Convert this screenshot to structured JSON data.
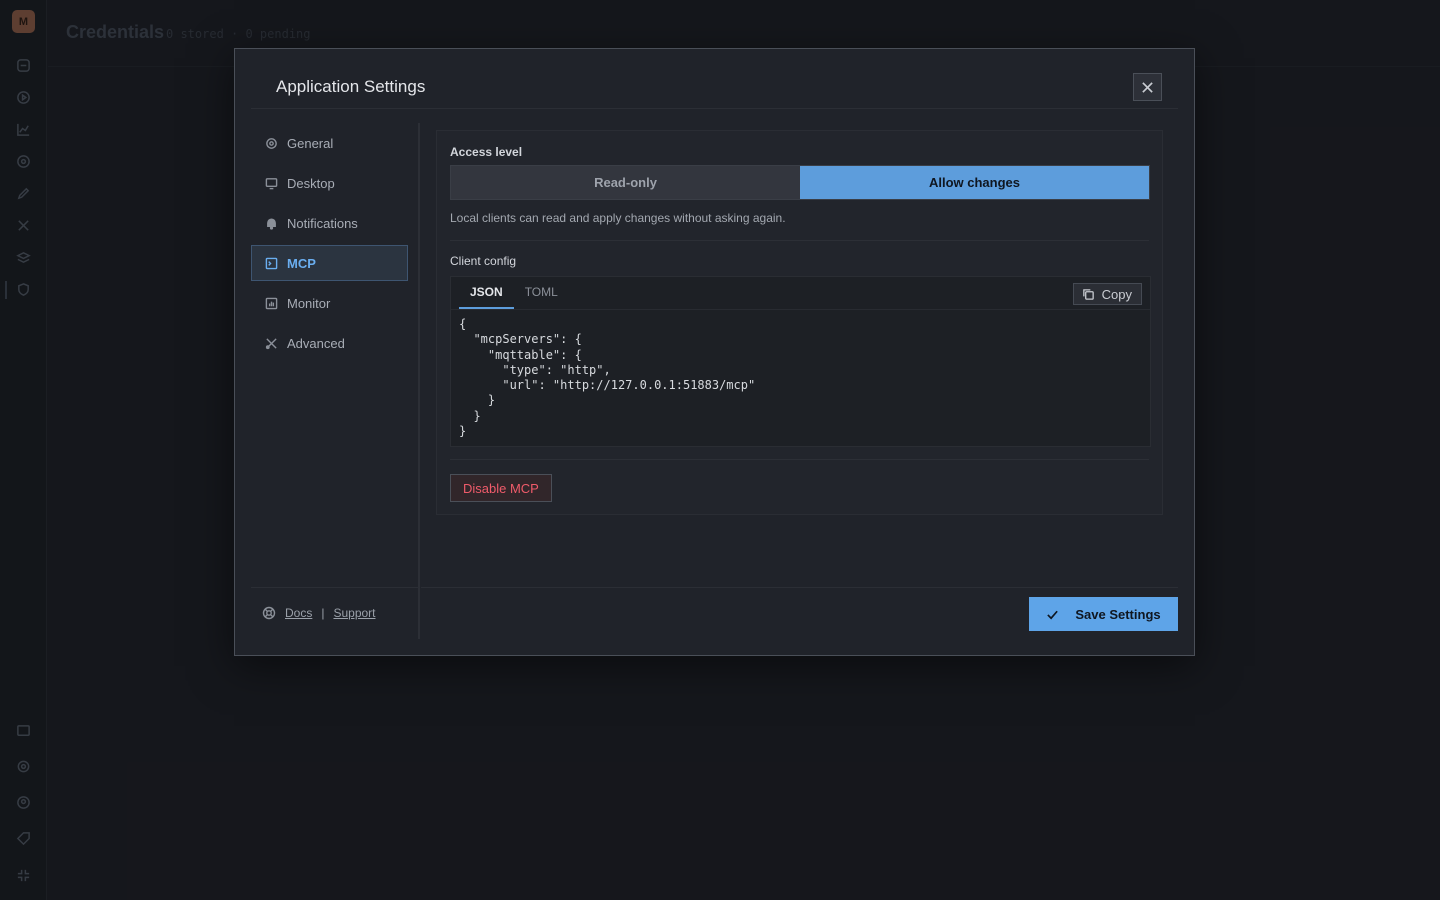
{
  "rail": {
    "logo_letter": "M",
    "icons": [
      "database-icon",
      "play-circle-icon",
      "chart-icon",
      "target-icon",
      "pen-icon",
      "tools-icon",
      "layers-icon",
      "shield-icon",
      "terminal-icon",
      "gear-icon",
      "user-circle-icon",
      "tag-icon",
      "collapse-icon"
    ]
  },
  "page": {
    "title": "Credentials",
    "meta": "0 stored · 0 pending"
  },
  "modal": {
    "title": "Application Settings",
    "nav": [
      {
        "label": "General",
        "icon": "gear-icon"
      },
      {
        "label": "Desktop",
        "icon": "monitor-icon"
      },
      {
        "label": "Notifications",
        "icon": "bell-icon"
      },
      {
        "label": "MCP",
        "icon": "terminal-icon",
        "active": true
      },
      {
        "label": "Monitor",
        "icon": "bar-chart-icon"
      },
      {
        "label": "Advanced",
        "icon": "tools-icon"
      }
    ],
    "footer_links": {
      "docs": "Docs",
      "separator": "|",
      "support": "Support"
    },
    "mcp": {
      "access_label": "Access level",
      "options": {
        "read_only": "Read-only",
        "allow_changes": "Allow changes"
      },
      "selected_option": "Allow changes",
      "access_description": "Local clients can read and apply changes without asking again.",
      "client_config_label": "Client config",
      "tabs": {
        "json": "JSON",
        "toml": "TOML"
      },
      "active_tab": "JSON",
      "copy_label": "Copy",
      "config_code": "{\n  \"mcpServers\": {\n    \"mqttable\": {\n      \"type\": \"http\",\n      \"url\": \"http://127.0.0.1:51883/mcp\"\n    }\n  }\n}",
      "disable_label": "Disable MCP"
    },
    "save_label": "Save Settings"
  },
  "colors": {
    "accent": "#5ea4e8",
    "danger": "#ef5b6a",
    "background": "#1c1e24",
    "modal_background": "#20232a"
  }
}
